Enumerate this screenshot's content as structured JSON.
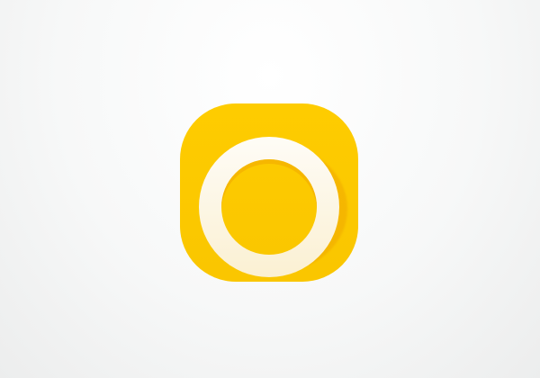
{
  "app_icon": {
    "icon": "yellow-ring-app-icon",
    "colors": {
      "tile": "#fecc00",
      "ring": "#ffffff",
      "shadow": "#f0a800",
      "background": "#f4f5f5"
    }
  }
}
